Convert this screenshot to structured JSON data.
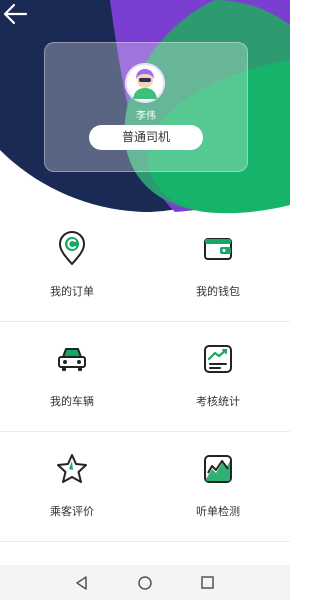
{
  "header": {
    "back_icon": "arrow-left-icon",
    "user_name": "李伟",
    "role_label": "普通司机"
  },
  "menu": {
    "items": [
      {
        "label": "我的订单",
        "icon": "location-pin-icon"
      },
      {
        "label": "我的钱包",
        "icon": "wallet-icon"
      },
      {
        "label": "我的车辆",
        "icon": "car-icon"
      },
      {
        "label": "考核统计",
        "icon": "stats-chart-icon"
      },
      {
        "label": "乘客评价",
        "icon": "star-icon"
      },
      {
        "label": "听单检测",
        "icon": "listen-check-icon"
      }
    ]
  },
  "system_nav": {
    "items": [
      "back-triangle-icon",
      "home-circle-icon",
      "recent-square-icon"
    ]
  },
  "colors": {
    "navy": "#1b2a55",
    "purple": "#7a3fd0",
    "green": "#15b46a",
    "icon_green": "#18a865",
    "icon_dark": "#232323"
  }
}
